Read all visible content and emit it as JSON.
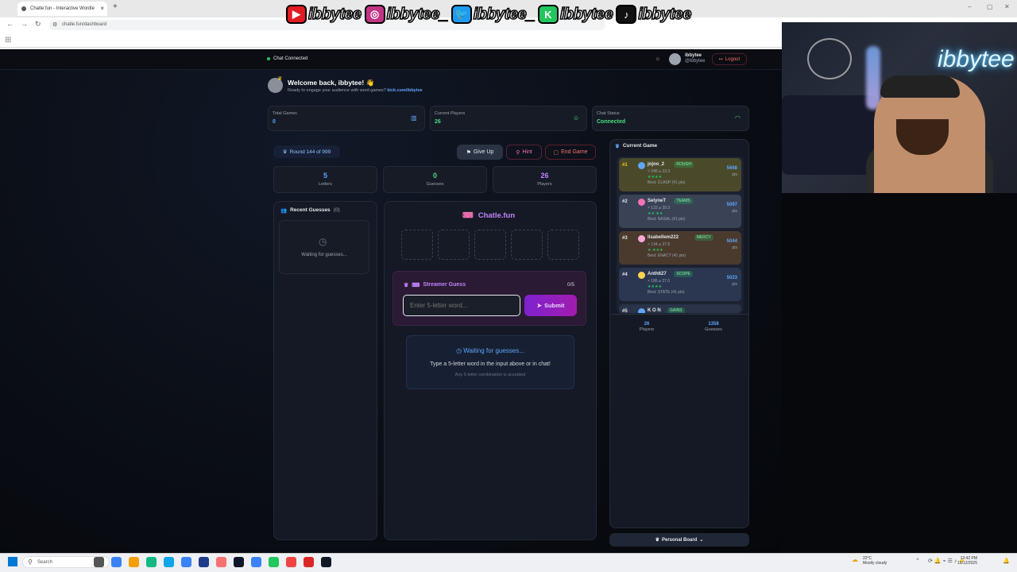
{
  "browser": {
    "tab_title": "Chatle.fun - Interactive Wordle",
    "url": "chatle.fun/dashboard",
    "new_tab": "+",
    "close": "×",
    "win_min": "–",
    "win_max": "▢",
    "win_close": "✕"
  },
  "socials": [
    {
      "icon": "youtube-icon",
      "color": "#e11d24",
      "glyph": "▶",
      "name": "ibbytee"
    },
    {
      "icon": "instagram-icon",
      "color": "#c13584",
      "glyph": "◎",
      "name": "ibbytee_"
    },
    {
      "icon": "twitter-icon",
      "color": "#1d9bf0",
      "glyph": "🐦",
      "name": "ibbytee_"
    },
    {
      "icon": "kick-icon",
      "color": "#22c55e",
      "glyph": "K",
      "name": "ibbytee"
    },
    {
      "icon": "tiktok-icon",
      "color": "#111111",
      "glyph": "♪",
      "name": "ibbytee"
    }
  ],
  "webcam": {
    "neon": "ibbytee"
  },
  "header": {
    "chat_status": "Chat Connected",
    "username": "ibbytee",
    "handle": "@ibbytee",
    "logout": "Logout"
  },
  "welcome": {
    "title": "Welcome back, ibbytee! 👋",
    "subtitle": "Ready to engage your audience with word games?",
    "link": "kick.com/ibbytee"
  },
  "stats": [
    {
      "label": "Total Games",
      "value": "0",
      "icon": "chart-icon",
      "color": "#60a5fa"
    },
    {
      "label": "Current Players",
      "value": "26",
      "icon": "user-icon",
      "color": "#4ade80"
    },
    {
      "label": "Chat Status",
      "value": "Connected",
      "icon": "wifi-icon",
      "color": "#4ade80"
    }
  ],
  "round": {
    "label": "Round 144 of 999"
  },
  "controls": {
    "give_up": "Give Up",
    "hint": "Hint",
    "end_game": "End Game"
  },
  "counters": [
    {
      "value": "5",
      "label": "Letters",
      "color": "#60a5fa"
    },
    {
      "value": "0",
      "label": "Guesses",
      "color": "#4ade80"
    },
    {
      "value": "26",
      "label": "Players",
      "color": "#c084fc"
    }
  ],
  "recent": {
    "title": "Recent Guesses",
    "count": "(0)",
    "empty": "Waiting for guesses..."
  },
  "board": {
    "brand": "Chatle.fun",
    "tiles": [
      "",
      "",
      "",
      "",
      ""
    ]
  },
  "streamer": {
    "title": "Streamer Guess",
    "progress": "0/5",
    "placeholder": "Enter 5-letter word...",
    "submit": "Submit"
  },
  "waiting": {
    "title": "Waiting for guesses...",
    "line1": "Type a 5-letter word in the input above or in chat!",
    "line2": "Any 5-letter combination is accepted"
  },
  "current_game": {
    "title": "Current Game",
    "leaderboard": [
      {
        "rank": "#1",
        "name": "jojoo_2",
        "tag": "ROUGH",
        "stats": "× 245 ⌀ 23.3",
        "stars": "★★★★",
        "best": "Best: CLASP (41 pts)",
        "pts": "5668",
        "unit": "pts",
        "bg": "#4a4a2a"
      },
      {
        "rank": "#2",
        "name": "SelyneT",
        "tag": "TEAMS",
        "stats": "× 133 ⌀ 39.3",
        "stars": "★★ ★★",
        "best": "Best: NASAL (41 pts)",
        "pts": "5097",
        "unit": "pts",
        "bg": "#3a4256"
      },
      {
        "rank": "#3",
        "name": "lisabellem222",
        "tag": "MERCY",
        "stats": "× 134 ⌀ 37.8",
        "stars": "★·★★★",
        "best": "Best: ENACT (41 pts)",
        "pts": "5044",
        "unit": "pts",
        "bg": "#4a3a2e"
      },
      {
        "rank": "#4",
        "name": "Anth627",
        "tag": "SCOPE",
        "stats": "× 186 ⌀ 27.0",
        "stars": "★★★★",
        "best": "Best: STATE (41 pts)",
        "pts": "5023",
        "unit": "pts",
        "bg": "#2b3650"
      },
      {
        "rank": "#5",
        "name": "K O N",
        "tag": "GAINS",
        "stats": "",
        "stars": "",
        "best": "",
        "pts": "",
        "unit": "",
        "bg": "#2a3348"
      }
    ],
    "footer": [
      {
        "value": "26",
        "label": "Players"
      },
      {
        "value": "1358",
        "label": "Guesses"
      }
    ]
  },
  "personal_board": "Personal Board",
  "taskbar": {
    "search": "Search",
    "weather_temp": "22°C",
    "weather_desc": "Mostly cloudy",
    "time": "12:42 PM",
    "date": "15/12/2025"
  }
}
